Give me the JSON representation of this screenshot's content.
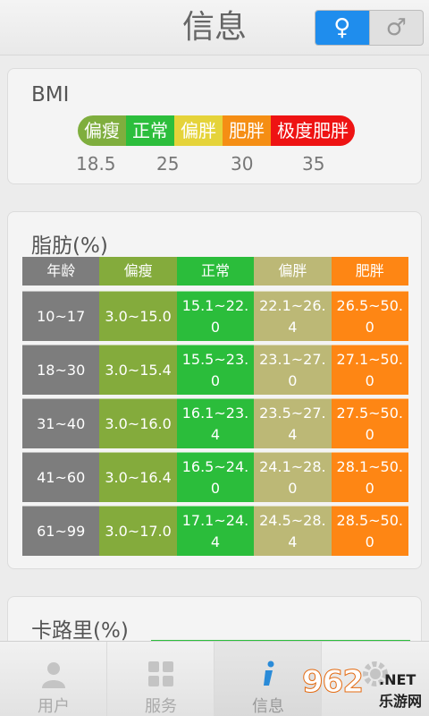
{
  "header": {
    "title": "信息",
    "gender": {
      "female_symbol": "♀",
      "male_symbol": "♂",
      "selected": "female"
    }
  },
  "bmi": {
    "title": "BMI",
    "segments": [
      {
        "label": "偏瘦",
        "color": "#7fae3e"
      },
      {
        "label": "正常",
        "color": "#2cbe3c"
      },
      {
        "label": "偏胖",
        "color": "#e5d33a"
      },
      {
        "label": "肥胖",
        "color": "#f58e14"
      },
      {
        "label": "极度肥胖",
        "color": "#ee1313"
      }
    ],
    "ticks": [
      "18.5",
      "25",
      "30",
      "35"
    ]
  },
  "fat": {
    "title": "脂肪(%)",
    "headers": [
      "年龄",
      "偏瘦",
      "正常",
      "偏胖",
      "肥胖"
    ],
    "column_colors": [
      "#7d7d7d",
      "#84ab3c",
      "#2bbd3b",
      "#bcb876",
      "#fe8614"
    ],
    "rows": [
      [
        "10~17",
        "3.0~15.0",
        "15.1~22.0",
        "22.1~26.4",
        "26.5~50.0"
      ],
      [
        "18~30",
        "3.0~15.4",
        "15.5~23.0",
        "23.1~27.0",
        "27.1~50.0"
      ],
      [
        "31~40",
        "3.0~16.0",
        "16.1~23.4",
        "23.5~27.4",
        "27.5~50.0"
      ],
      [
        "41~60",
        "3.0~16.4",
        "16.5~24.0",
        "24.1~28.0",
        "28.1~50.0"
      ],
      [
        "61~99",
        "3.0~17.0",
        "17.1~24.4",
        "24.5~28.4",
        "28.5~50.0"
      ]
    ]
  },
  "calorie": {
    "title": "卡路里(%)"
  },
  "nav": {
    "items": [
      {
        "label": "用户",
        "icon": "user-icon"
      },
      {
        "label": "服务",
        "icon": "grid-icon"
      },
      {
        "label": "信息",
        "icon": "info-icon",
        "active": true
      },
      {
        "label": "",
        "icon": "gear-icon"
      }
    ]
  },
  "watermark": {
    "logo": "962",
    "net": ".NET",
    "cn": "乐游网"
  }
}
